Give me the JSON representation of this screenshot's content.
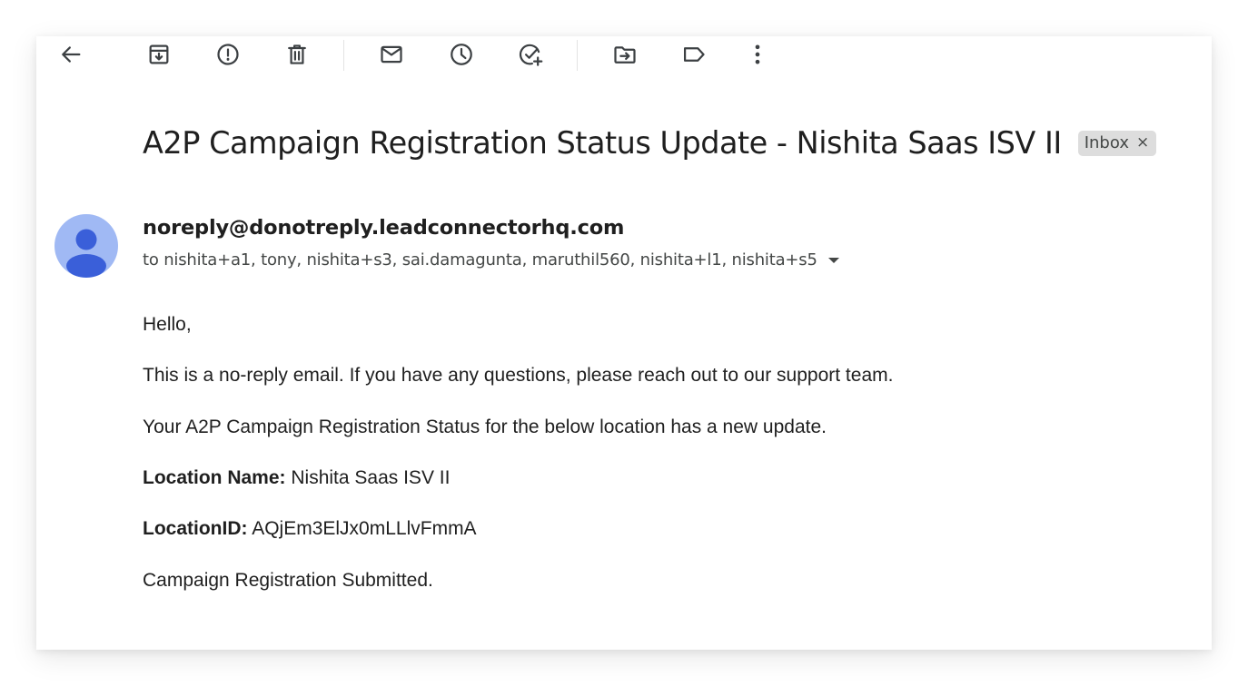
{
  "toolbar": {
    "buttons": [
      {
        "name": "back",
        "icon": "arrow-left-icon"
      },
      {
        "name": "archive",
        "icon": "archive-icon"
      },
      {
        "name": "report-spam",
        "icon": "report-spam-icon"
      },
      {
        "name": "delete",
        "icon": "trash-icon"
      },
      {
        "name": "mark-unread",
        "icon": "mail-icon"
      },
      {
        "name": "snooze",
        "icon": "clock-icon"
      },
      {
        "name": "add-to-tasks",
        "icon": "add-task-icon"
      },
      {
        "name": "move-to",
        "icon": "move-to-folder-icon"
      },
      {
        "name": "labels",
        "icon": "label-icon"
      },
      {
        "name": "more",
        "icon": "more-vert-icon"
      }
    ]
  },
  "email": {
    "subject": "A2P Campaign Registration Status Update - Nishita Saas ISV II",
    "label": "Inbox",
    "label_close": "×",
    "sender": "noreply@donotreply.leadconnectorhq.com",
    "recipients": "to nishita+a1, tony, nishita+s3, sai.damagunta, maruthil560, nishita+l1, nishita+s5",
    "body": {
      "greeting": "Hello,",
      "line1": "This is a no-reply email. If you have any questions, please reach out to our support team.",
      "line2": "Your A2P Campaign Registration Status for the below location has a new update.",
      "location_name_label": "Location Name:",
      "location_name_value": "Nishita Saas ISV II",
      "location_id_label": "LocationID:",
      "location_id_value": "AQjEm3ElJx0mLLlvFmmA",
      "status": "Campaign Registration Submitted."
    }
  },
  "colors": {
    "avatar_bg": "#a0b9f4",
    "avatar_fg": "#3a5fd9",
    "text_primary": "#1f1f1f",
    "text_secondary": "#444746",
    "chip_bg": "#dddddd"
  }
}
